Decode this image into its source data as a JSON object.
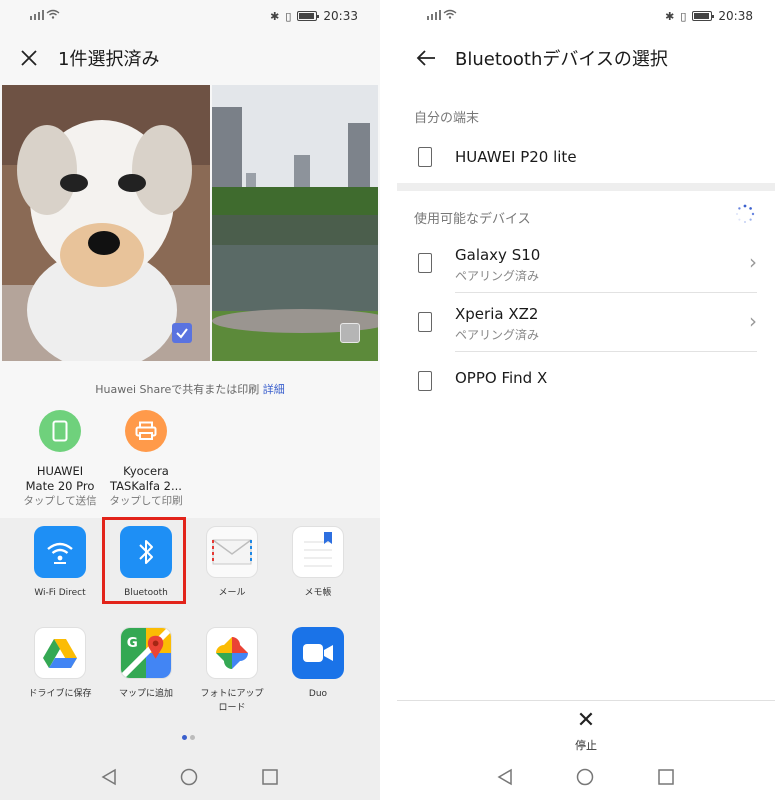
{
  "left": {
    "status": {
      "time": "20:33"
    },
    "header": {
      "title": "1件選択済み"
    },
    "share_hint": {
      "text": "Huawei Shareで共有または印刷",
      "link": "詳細"
    },
    "devices": [
      {
        "name_line1": "HUAWEI",
        "name_line2": "Mate 20 Pro",
        "sub": "タップして送信",
        "color": "#6fd17c"
      },
      {
        "name_line1": "Kyocera",
        "name_line2": "TASKalfa 2...",
        "sub": "タップして印刷",
        "color": "#ff9a4a"
      }
    ],
    "apps": [
      {
        "label": "Wi-Fi Direct",
        "icon": "wifi-direct-icon"
      },
      {
        "label": "Bluetooth",
        "icon": "bluetooth-icon"
      },
      {
        "label": "メール",
        "icon": "mail-icon"
      },
      {
        "label": "メモ帳",
        "icon": "notepad-icon"
      },
      {
        "label": "ドライブに保存",
        "icon": "google-drive-icon"
      },
      {
        "label": "マップに追加",
        "icon": "google-maps-icon"
      },
      {
        "label": "フォトにアップ\nロード",
        "icon": "google-photos-icon"
      },
      {
        "label": "Duo",
        "icon": "duo-icon"
      }
    ],
    "colors": {
      "accent": "#3a5fcd",
      "highlight": "#e2231a"
    }
  },
  "right": {
    "status": {
      "time": "20:38"
    },
    "header": {
      "title": "Bluetoothデバイスの選択"
    },
    "my_device_section": "自分の端末",
    "my_device": "HUAWEI P20 lite",
    "available_section": "使用可能なデバイス",
    "available": [
      {
        "name": "Galaxy S10",
        "status": "ペアリング済み"
      },
      {
        "name": "Xperia XZ2",
        "status": "ペアリング済み"
      },
      {
        "name": "OPPO Find X",
        "status": ""
      }
    ],
    "stop_label": "停止"
  }
}
